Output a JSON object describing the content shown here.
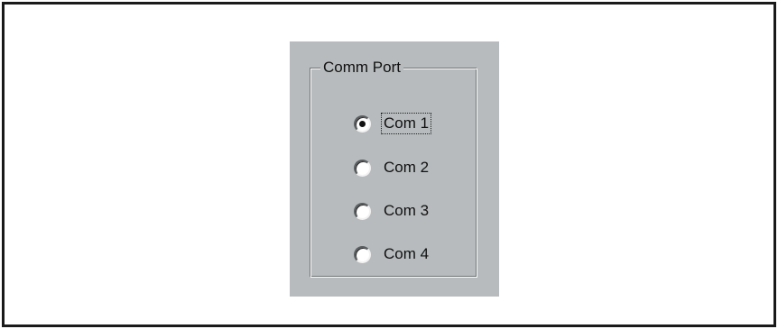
{
  "groupbox": {
    "title": "Comm Port",
    "selected": "Com 1",
    "options": [
      {
        "label": "Com 1",
        "checked": true,
        "focused": true
      },
      {
        "label": "Com 2",
        "checked": false,
        "focused": false
      },
      {
        "label": "Com 3",
        "checked": false,
        "focused": false
      },
      {
        "label": "Com 4",
        "checked": false,
        "focused": false
      }
    ]
  },
  "colors": {
    "panel_background": "#b7bbbd",
    "frame_border": "#1a1a1a",
    "radio_fill": "#ffffff",
    "radio_dot": "#111111"
  }
}
